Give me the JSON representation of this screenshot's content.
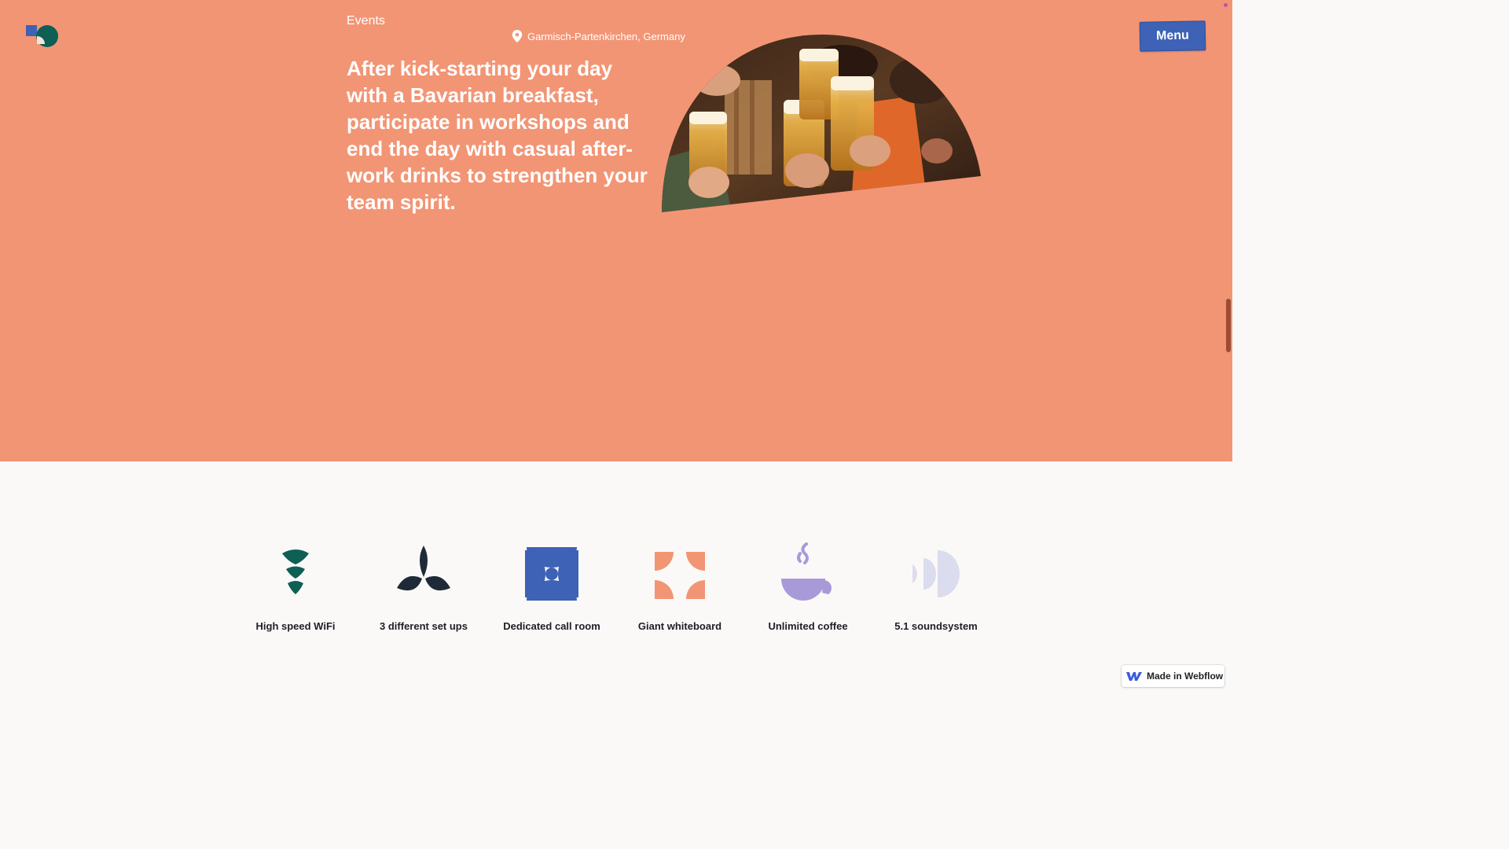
{
  "header": {
    "eyebrow": "Events",
    "location": "Garmisch-Partenkirchen, Germany",
    "menu_label": "Menu"
  },
  "hero": {
    "headline": "After kick-starting your day with a Bavarian breakfast, participate in workshops and end the day with casual after-work drinks to strengthen your team spirit.",
    "photo_icon": "beer-toast-photo"
  },
  "features": [
    {
      "label": "High speed WiFi",
      "icon": "wifi-icon"
    },
    {
      "label": "3 different set ups",
      "icon": "leaf-icon"
    },
    {
      "label": "Dedicated call room",
      "icon": "call-room-icon"
    },
    {
      "label": "Giant whiteboard",
      "icon": "whiteboard-icon"
    },
    {
      "label": "Unlimited coffee",
      "icon": "coffee-icon"
    },
    {
      "label": "5.1 soundsystem",
      "icon": "sound-icon"
    }
  ],
  "badge": {
    "label": "Made in Webflow"
  },
  "colors": {
    "hero_bg": "#f29575",
    "menu_bg": "#3d62b6",
    "page_bg": "#fbf9f8",
    "teal": "#0e5f54",
    "navy": "#1f2a38",
    "blue": "#3d62b6",
    "orange": "#f29575",
    "lavender": "#a89ad8",
    "pale": "#dcdcef"
  }
}
